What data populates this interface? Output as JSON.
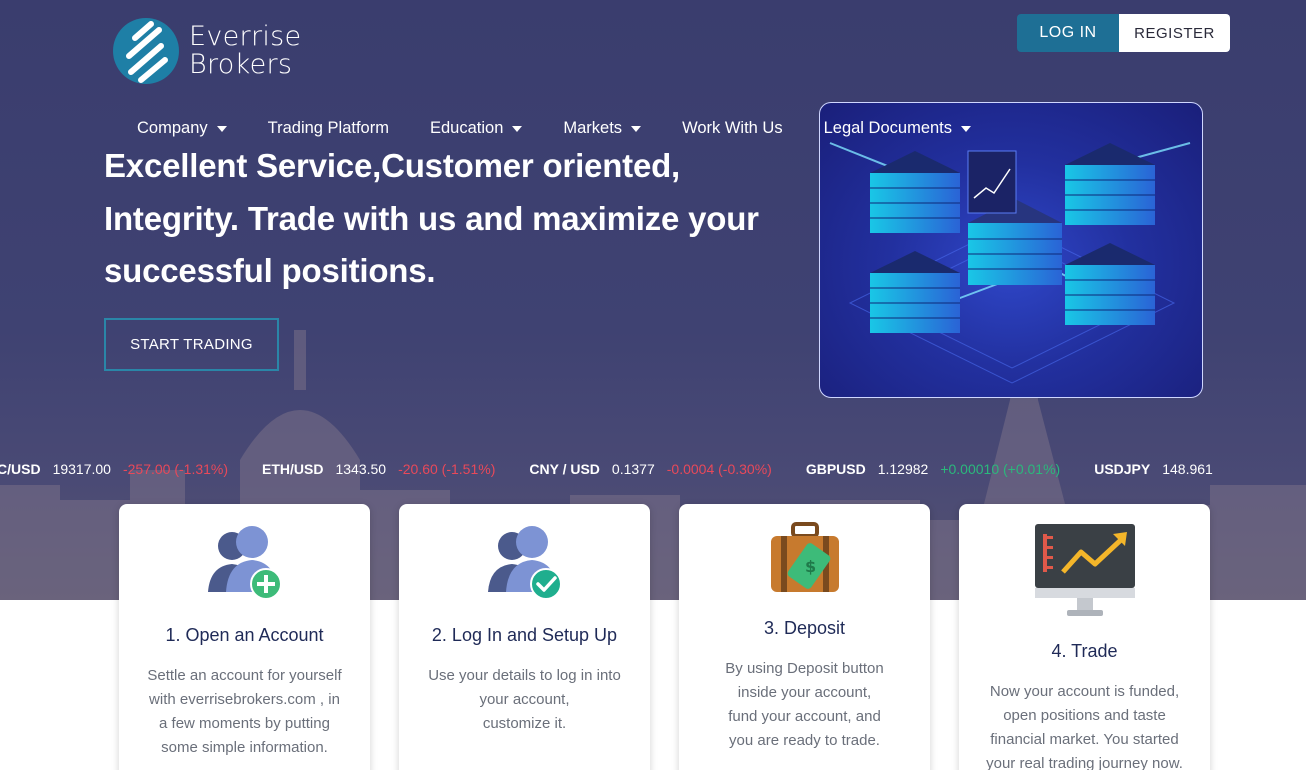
{
  "brand": {
    "line1": "Everrise",
    "line2": "Brokers"
  },
  "auth": {
    "login": "LOG IN",
    "register": "REGISTER"
  },
  "nav": [
    {
      "label": "Company",
      "dropdown": true
    },
    {
      "label": "Trading Platform",
      "dropdown": false
    },
    {
      "label": "Education",
      "dropdown": true
    },
    {
      "label": "Markets",
      "dropdown": true
    },
    {
      "label": "Work With Us",
      "dropdown": false
    },
    {
      "label": "Legal Documents",
      "dropdown": true
    }
  ],
  "hero": {
    "headline": "Excellent Service,Customer oriented, Integrity. Trade with us and maximize your successful positions.",
    "cta": "START TRADING"
  },
  "ticker": [
    {
      "symbol": "C/USD",
      "price": "19317.00",
      "change": "-257.00 (-1.31%)",
      "dir": "down"
    },
    {
      "symbol": "ETH/USD",
      "price": "1343.50",
      "change": "-20.60 (-1.51%)",
      "dir": "down"
    },
    {
      "symbol": "CNY / USD",
      "price": "0.1377",
      "change": "-0.0004 (-0.30%)",
      "dir": "down"
    },
    {
      "symbol": "GBPUSD",
      "price": "1.12982",
      "change": "+0.00010 (+0.01%)",
      "dir": "up"
    },
    {
      "symbol": "USDJPY",
      "price": "148.961",
      "change": "",
      "dir": "up"
    }
  ],
  "steps": [
    {
      "title": "1. Open an Account",
      "icon": "add-user-icon",
      "body": [
        "Settle an account for yourself",
        "with everrisebrokers.com , in",
        "a few moments by putting",
        "some simple information."
      ]
    },
    {
      "title": "2. Log In and Setup Up",
      "icon": "verified-user-icon",
      "body": [
        "Use your details to log in into",
        "your account,",
        "customize it."
      ]
    },
    {
      "title": "3. Deposit",
      "icon": "money-briefcase-icon",
      "body": [
        "By using Deposit button",
        "inside your account,",
        "fund your account, and",
        "you are ready to trade."
      ]
    },
    {
      "title": "4. Trade",
      "icon": "trading-monitor-icon",
      "body": [
        "Now your account is funded,",
        "open positions and taste",
        "financial market. You started",
        "your real trading journey now."
      ]
    }
  ],
  "colors": {
    "hero_bg": "#3f4272",
    "accent": "#1e6f95",
    "down": "#e8495a",
    "up": "#2bb87c",
    "title": "#1f2a57"
  }
}
